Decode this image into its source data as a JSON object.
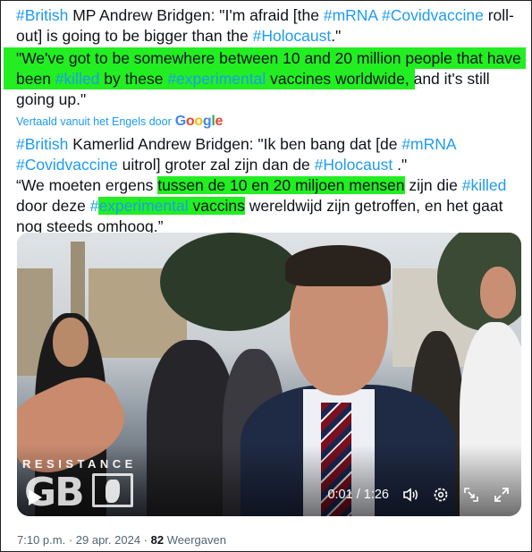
{
  "original": {
    "line1": {
      "tag1": "#British",
      "text1": " MP Andrew Bridgen: \"I'm afraid [the ",
      "tag2": "#mRNA",
      "tag3": "#Covidvaccine",
      "text2": " roll-"
    },
    "line2": {
      "text1": "out] is going to be bigger than the ",
      "tag1": "#Holocaust",
      "text2": ".\""
    },
    "line3": {
      "text1": "\"We've got to be somewhere between 10 and 20 million people that have"
    },
    "line4": {
      "text1": "been ",
      "tag1": "#killed",
      "text2": " by these ",
      "tag2": "#experimental",
      "text3": " vaccines worldwide,",
      "text4": " and it's still"
    },
    "line5": {
      "text1": "going up.\""
    }
  },
  "translation_note": {
    "label": "Vertaald vanuit het Engels door",
    "provider": "Google"
  },
  "translation": {
    "line1": {
      "tag1": "#British",
      "text1": " Kamerlid Andrew Bridgen: \"Ik ben bang dat [de ",
      "tag2": "#mRNA"
    },
    "line2": {
      "tag1": "#Covidvaccine",
      "text1": " uitrol] groter zal zijn dan de ",
      "tag2": "#Holocaust",
      "text2": " .\""
    },
    "line3": {
      "text1": "“We moeten ergens ",
      "hl1": "tussen de 10 en 20 miljoen mensen",
      "text2": " zijn die ",
      "tag1": "#killed"
    },
    "line4": {
      "text1": "door deze ",
      "tag1": "#",
      "hl_tag": "experimental",
      "hl_text": " vaccins",
      "text2": " wereldwijd zijn getroffen, en het gaat"
    },
    "line5": {
      "text1": "nog steeds omhoog.”"
    }
  },
  "video": {
    "brand_top": "RESISTANCE",
    "brand_main": "GB",
    "time": "0:01 / 1:26",
    "icons": [
      "play-icon",
      "volume-icon",
      "settings-icon",
      "exit-fullscreen-icon",
      "fullscreen-icon"
    ]
  },
  "footer": {
    "time": "7:10 p.m.",
    "sep1": " · ",
    "date": "29 apr. 2024",
    "sep2": " · ",
    "views": "82",
    "views_label": " Weergaven"
  },
  "colors": {
    "hashtag": "#1d9bf0",
    "highlight": "#22ee22",
    "muted": "#536471"
  }
}
